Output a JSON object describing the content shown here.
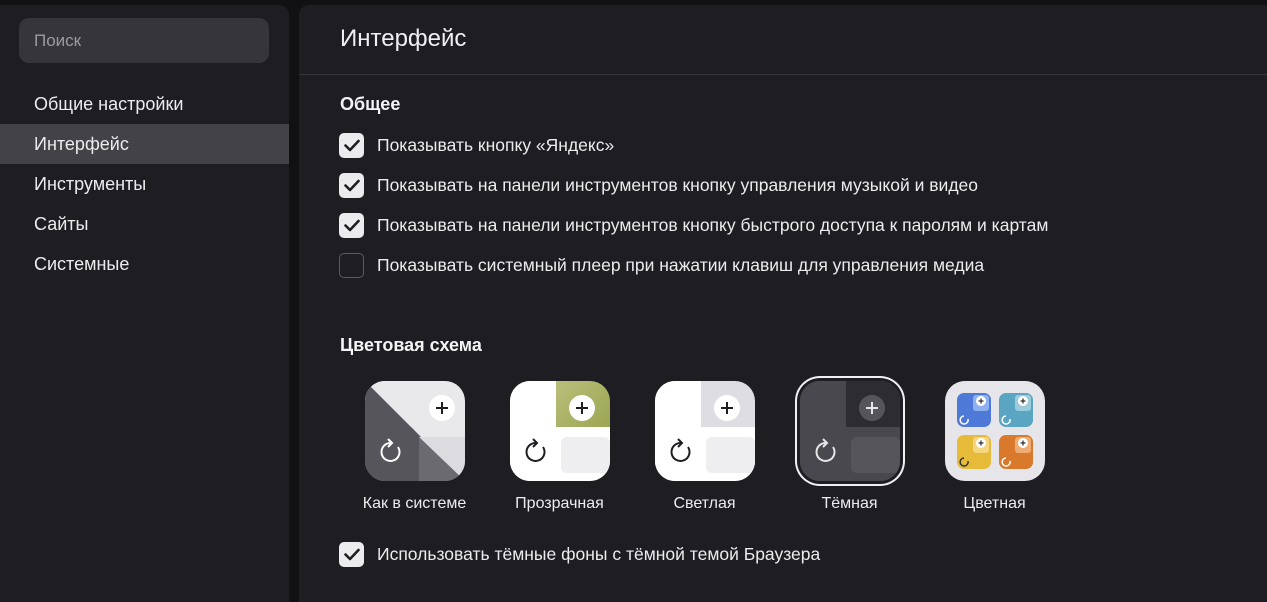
{
  "sidebar": {
    "search_placeholder": "Поиск",
    "items": [
      {
        "label": "Общие настройки",
        "active": false
      },
      {
        "label": "Интерфейс",
        "active": true
      },
      {
        "label": "Инструменты",
        "active": false
      },
      {
        "label": "Сайты",
        "active": false
      },
      {
        "label": "Системные",
        "active": false
      }
    ]
  },
  "main": {
    "title": "Интерфейс",
    "general": {
      "title": "Общее",
      "options": [
        {
          "label": "Показывать кнопку «Яндекс»",
          "checked": true
        },
        {
          "label": "Показывать на панели инструментов кнопку управления музыкой и видео",
          "checked": true
        },
        {
          "label": "Показывать на панели инструментов кнопку быстрого доступа к паролям и картам",
          "checked": true
        },
        {
          "label": "Показывать системный плеер при нажатии клавиш для управления медиа",
          "checked": false
        }
      ]
    },
    "color_scheme": {
      "title": "Цветовая схема",
      "themes": [
        {
          "label": "Как в системе",
          "selected": false
        },
        {
          "label": "Прозрачная",
          "selected": false
        },
        {
          "label": "Светлая",
          "selected": false
        },
        {
          "label": "Тёмная",
          "selected": true
        },
        {
          "label": "Цветная",
          "selected": false
        }
      ],
      "dark_backgrounds": {
        "label": "Использовать тёмные фоны с тёмной темой Браузера",
        "checked": true
      }
    }
  },
  "colors": {
    "background": "#111114",
    "panel": "#1e1e22",
    "active_item": "#424247",
    "text": "#ececee"
  }
}
